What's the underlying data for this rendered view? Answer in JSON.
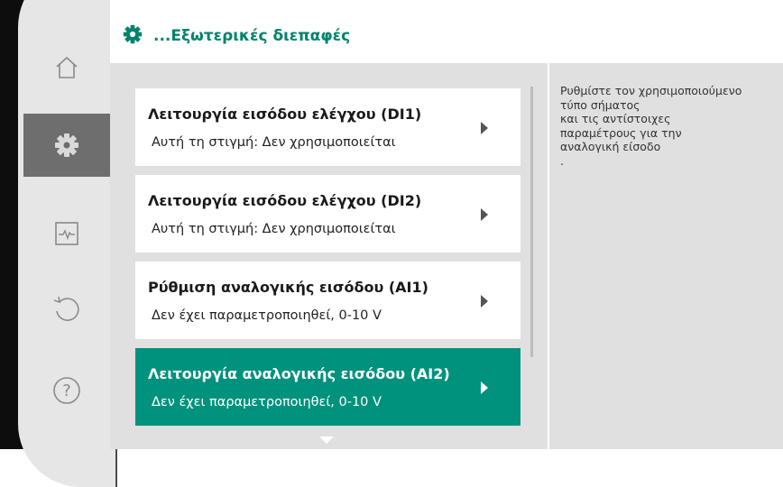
{
  "header": {
    "title": "...Εξωτερικές διεπαφές",
    "icon": "gear-icon",
    "accent": "#00836e"
  },
  "sidebar": {
    "items": [
      {
        "name": "home",
        "icon": "home-icon",
        "active": false
      },
      {
        "name": "settings",
        "icon": "gear-icon",
        "active": true
      },
      {
        "name": "diagnostics",
        "icon": "pulse-icon",
        "active": false
      },
      {
        "name": "restore",
        "icon": "undo-icon",
        "active": false
      },
      {
        "name": "help",
        "icon": "question-icon",
        "active": false
      }
    ]
  },
  "list": {
    "items": [
      {
        "title": "Λειτουργία εισόδου ελέγχου (DI1)",
        "subtitle": "Αυτή τη στιγμή: Δεν χρησιμοποιείται",
        "selected": false
      },
      {
        "title": "Λειτουργία εισόδου ελέγχου (DI2)",
        "subtitle": "Αυτή τη στιγμή: Δεν χρησιμοποιείται",
        "selected": false
      },
      {
        "title": "Ρύθμιση αναλογικής εισόδου (AI1)",
        "subtitle": "Δεν έχει παραμετροποιηθεί, 0-10 V",
        "selected": false
      },
      {
        "title": "Λειτουργία αναλογικής εισόδου (AI2)",
        "subtitle": "Δεν έχει παραμετροποιηθεί, 0-10 V",
        "selected": true
      }
    ],
    "selected_color": "#00927d"
  },
  "help": {
    "text": "Ρυθμίστε τον χρησιμοποιούμενο\nτύπο σήματος\nκαι τις αντίστοιχες\nπαραμέτρους για την\nαναλογική είσοδο\n."
  }
}
